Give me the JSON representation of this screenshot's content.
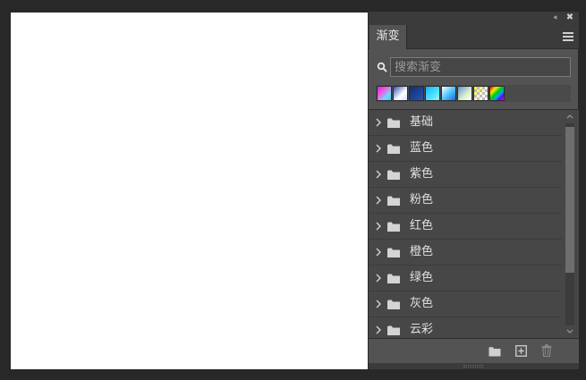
{
  "panel": {
    "tab_label": "渐变",
    "collapse_glyph": "‹‹",
    "close_glyph": "✖"
  },
  "search": {
    "placeholder": "搜索渐变",
    "value": ""
  },
  "swatches": [
    {
      "name": "purple-pink-cyan"
    },
    {
      "name": "blue-white"
    },
    {
      "name": "dark-blue"
    },
    {
      "name": "cyan"
    },
    {
      "name": "white-blue"
    },
    {
      "name": "blue-pale-green"
    },
    {
      "name": "yellow-transparent"
    },
    {
      "name": "spectrum"
    }
  ],
  "gradient_groups": [
    {
      "label": "基础"
    },
    {
      "label": "蓝色"
    },
    {
      "label": "紫色"
    },
    {
      "label": "粉色"
    },
    {
      "label": "红色"
    },
    {
      "label": "橙色"
    },
    {
      "label": "绿色"
    },
    {
      "label": "灰色"
    },
    {
      "label": "云彩"
    }
  ],
  "icons": {
    "search": "search-icon",
    "menu": "hamburger-menu-icon",
    "folder": "folder-icon",
    "chevron": "chevron-right-icon",
    "new_group": "new-folder-icon",
    "new_gradient": "add-square-icon",
    "delete": "trash-icon"
  },
  "colors": {
    "panel_bg": "#535353",
    "list_bg": "#474747",
    "dark_bg": "#282828",
    "text": "#e0e0e0"
  }
}
